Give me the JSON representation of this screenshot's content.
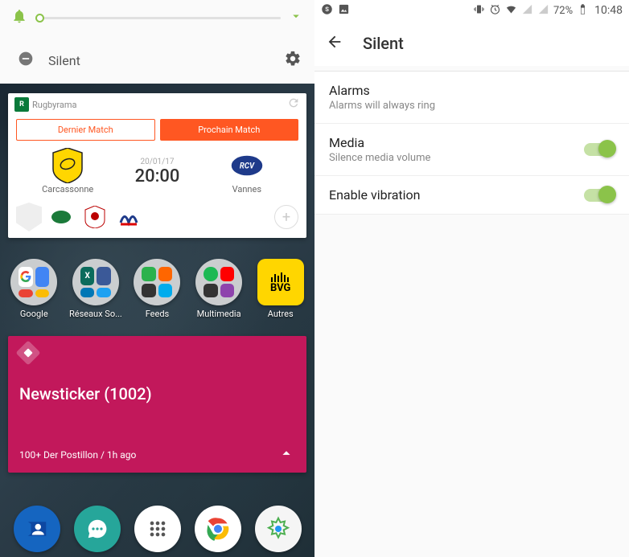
{
  "left": {
    "mode_label": "Silent",
    "rugby": {
      "app_name": "Rugbyrama",
      "tab_last": "Dernier Match",
      "tab_next": "Prochain Match",
      "home_team": "Carcassonne",
      "away_team": "Vannes",
      "date": "20/01/17",
      "time": "20:00"
    },
    "apps": {
      "google": "Google",
      "reseaux": "Réseaux So...",
      "feeds": "Feeds",
      "multimedia": "Multimedia",
      "autres": "Autres",
      "bvg": "BVG"
    },
    "news": {
      "title": "Newsticker (1002)",
      "footer": "100+ Der Postillon / 1h ago"
    }
  },
  "right": {
    "status": {
      "battery": "72%",
      "time": "10:48"
    },
    "title": "Silent",
    "alarms_label": "Alarms",
    "alarms_sub": "Alarms will always ring",
    "media_label": "Media",
    "media_sub": "Silence media volume",
    "vibration_label": "Enable vibration"
  }
}
